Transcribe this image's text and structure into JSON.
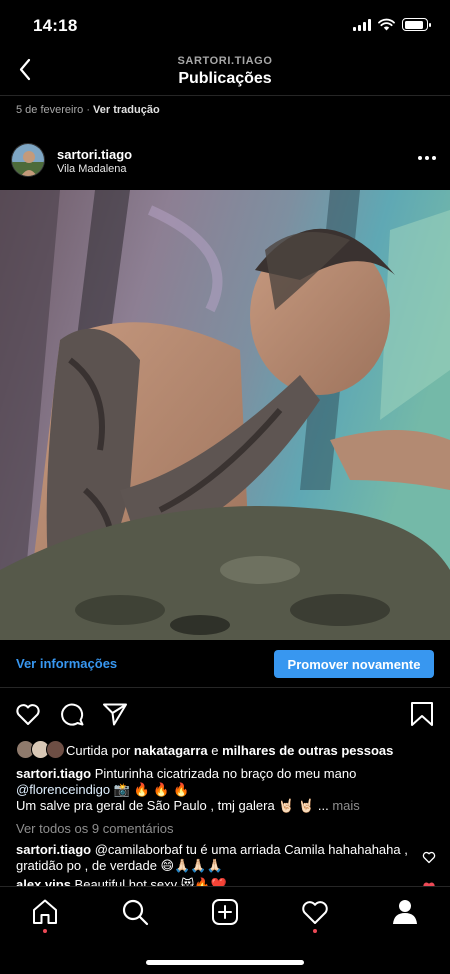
{
  "status_bar": {
    "time": "14:18",
    "battery_level": 0.9
  },
  "nav": {
    "account": "SARTORI.TIAGO",
    "title": "Publicações"
  },
  "previous_post": {
    "date": "5 de fevereiro",
    "separator": " · ",
    "translate": "Ver tradução"
  },
  "post": {
    "username": "sartori.tiago",
    "location": "Vila Madalena",
    "insights_label": "Ver informações",
    "promote_label": "Promover novamente",
    "likes": {
      "prefix": "Curtida por ",
      "user": "nakatagarra",
      "middle": " e ",
      "others": "milhares de outras pessoas"
    },
    "caption": {
      "username": "sartori.tiago",
      "line1": " Pinturinha cicatrizada no braço do meu mano",
      "mention": "@florenceindigo",
      "line2_emoji": " 📸 🔥 🔥 🔥",
      "line3": "Um salve pra geral de São Paulo , tmj galera 🤘🏻 🤘🏻 ...",
      "more": " mais"
    },
    "view_all_comments": "Ver todos os 9 comentários",
    "comments": [
      {
        "username": "sartori.tiago",
        "text": " @camilaborbaf tu é uma arriada Camila hahahahaha , gratidão po , de verdade 😄🙏🏻🙏🏻🙏🏻"
      },
      {
        "username": "alex.vips",
        "text": " Beautiful hot sexy 😻🔥❤️"
      }
    ]
  },
  "colors": {
    "accent": "#3897f0",
    "notification": "#ed4956",
    "like": "#ed4956"
  },
  "icons": [
    "back-chevron-icon",
    "more-options-icon",
    "heart-icon",
    "comment-icon",
    "share-icon",
    "bookmark-icon",
    "home-icon",
    "search-icon",
    "add-post-icon",
    "activity-heart-icon",
    "profile-icon"
  ]
}
